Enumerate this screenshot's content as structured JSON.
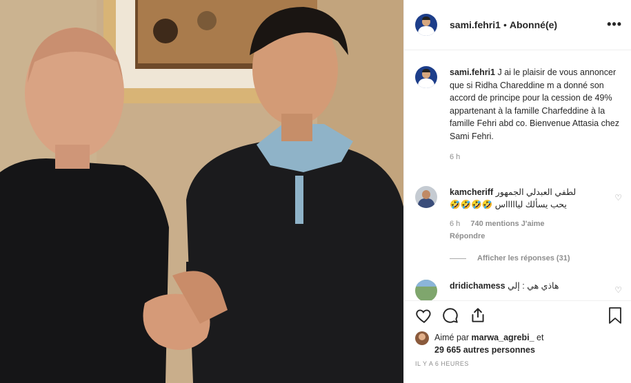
{
  "post": {
    "username": "sami.fehri1",
    "separator": "•",
    "follow_status": "Abonné(e)",
    "more_label": "•••",
    "caption": "J ai le plaisir de vous annoncer que si Ridha Chareddine m a donné son accord de principe pour la cession de 49% appartenant à la famille Charfeddine à la famille Fehri abd co. Bienvenue Attasia chez Sami Fehri.",
    "caption_time": "6 h"
  },
  "comments": [
    {
      "username": "kamcheriff",
      "text_line1": "لطفي العبدلي الجمهور",
      "text_line2": "يحب يسألك لياااااس 🤣🤣🤣🤣",
      "time": "6 h",
      "likes": "740 mentions J'aime",
      "reply": "Répondre",
      "show_replies": "Afficher les réponses (31)"
    },
    {
      "username": "dridichamess",
      "text": "هاذي هي : إلي"
    }
  ],
  "actions": {
    "liked_by_prefix": "Aimé par",
    "liked_by_user": "marwa_agrebi_",
    "liked_by_and": "et",
    "liked_by_others": "29 665 autres personnes",
    "timestamp": "IL Y A 6 HEURES"
  },
  "icons": {
    "like": "heart-icon",
    "comment": "comment-icon",
    "share": "share-icon",
    "save": "bookmark-icon",
    "more": "more-icon"
  },
  "colors": {
    "text": "#262626",
    "muted": "#8e8e8e",
    "border": "#efefef"
  }
}
